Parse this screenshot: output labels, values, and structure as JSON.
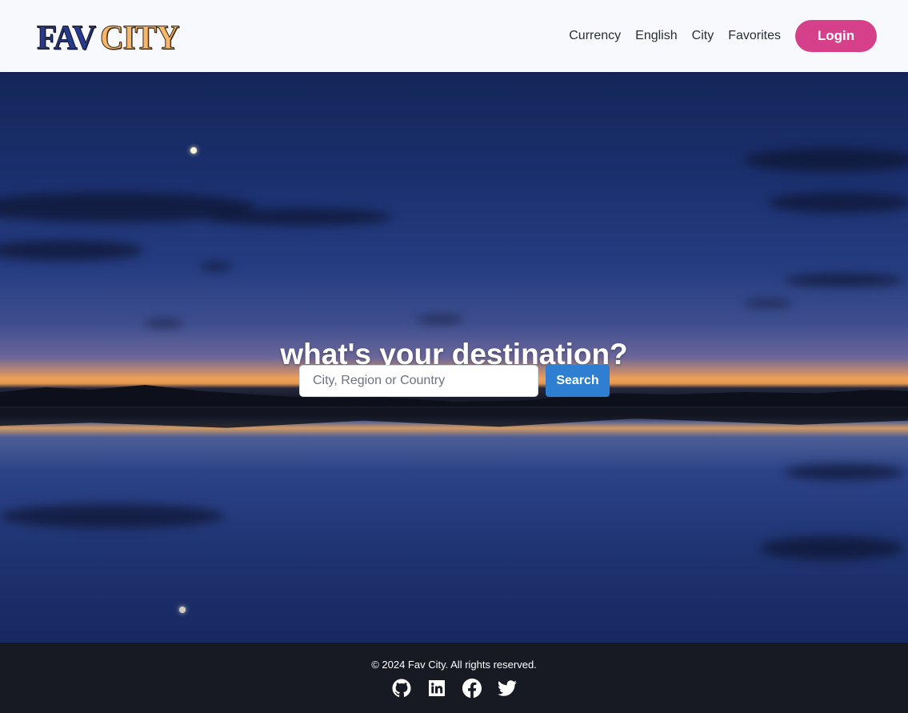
{
  "header": {
    "logo": {
      "part1": "FAV",
      "part2": "CITY"
    },
    "nav": [
      {
        "label": "Currency"
      },
      {
        "label": "English"
      },
      {
        "label": "City"
      },
      {
        "label": "Favorites"
      }
    ],
    "login_label": "Login"
  },
  "hero": {
    "title": "what's your destination?",
    "search": {
      "placeholder": "City, Region or Country",
      "value": ""
    },
    "search_button": "Search"
  },
  "footer": {
    "copyright": "© 2024 Fav City. All rights reserved.",
    "socials": [
      {
        "icon": "github-icon"
      },
      {
        "icon": "linkedin-icon"
      },
      {
        "icon": "facebook-icon"
      },
      {
        "icon": "twitter-icon"
      }
    ]
  },
  "colors": {
    "header_bg": "#f7f9fc",
    "login": "#d6408b",
    "search_button": "#2e7fd1",
    "footer_bg": "#171923",
    "logo_primary": "#263a8f",
    "logo_accent": "#f6b66b"
  }
}
